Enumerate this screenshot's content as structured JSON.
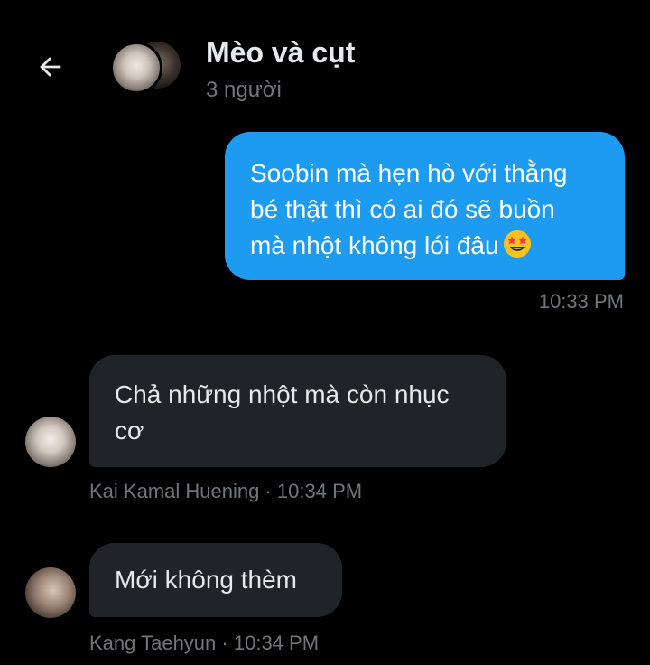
{
  "header": {
    "back_icon": "arrow-left-icon",
    "title": "Mèo và cụt",
    "subtitle": "3 người"
  },
  "messages": [
    {
      "direction": "sent",
      "lines": [
        "Soobin mà hẹn hò với thằng",
        "bé thật thì có ai đó sẽ buồn",
        "mà nhột không lói đâu"
      ],
      "emoji": "star-struck-emoji",
      "time": "10:33 PM"
    },
    {
      "direction": "received",
      "lines": [
        "Chả những nhột mà còn nhục",
        "cơ"
      ],
      "sender": "Kai Kamal Huening",
      "separator": "·",
      "time": "10:34 PM"
    },
    {
      "direction": "received",
      "text": "Mới không thèm",
      "sender": "Kang Taehyun",
      "separator": "·",
      "time": "10:34 PM"
    }
  ],
  "colors": {
    "background": "#000000",
    "sent_bubble": "#1d9bf0",
    "received_bubble": "#202327",
    "primary_text": "#e7e9ea",
    "secondary_text": "#71767b"
  }
}
